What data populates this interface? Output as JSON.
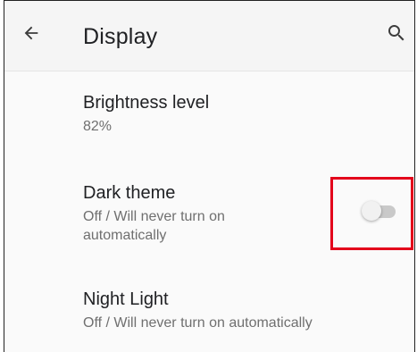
{
  "appbar": {
    "title": "Display",
    "back_icon": "arrow-back-icon",
    "search_icon": "search-icon"
  },
  "settings": [
    {
      "title": "Brightness level",
      "subtitle": "82%"
    },
    {
      "title": "Dark theme",
      "subtitle": "Off / Will never turn on automatically",
      "toggle_on": false
    },
    {
      "title": "Night Light",
      "subtitle": "Off / Will never turn on automatically"
    }
  ],
  "colors": {
    "highlight": "#e3001b",
    "text_primary": "#202124",
    "text_secondary": "#6f6f6f"
  }
}
